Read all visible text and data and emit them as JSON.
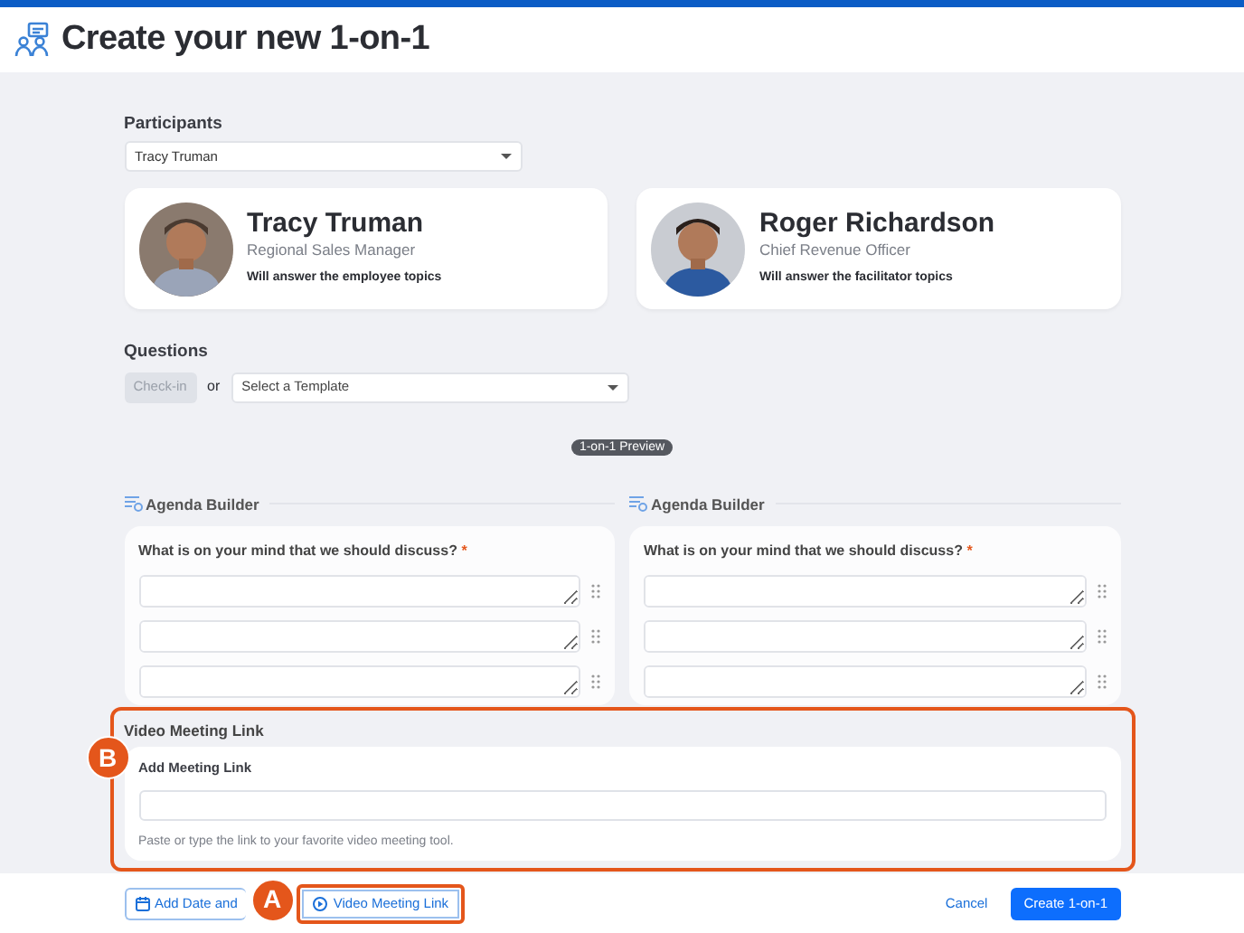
{
  "header": {
    "title": "Create your new 1-on-1"
  },
  "participants": {
    "label": "Participants",
    "value": "Tracy Truman"
  },
  "people": [
    {
      "name": "Tracy Truman",
      "role": "Regional Sales Manager",
      "note": "Will answer the employee topics"
    },
    {
      "name": "Roger Richardson",
      "role": "Chief Revenue Officer",
      "note": "Will answer the facilitator topics"
    }
  ],
  "questions": {
    "label": "Questions",
    "checkin": {
      "label": "Check-in",
      "disabled": true
    },
    "or_text": "or",
    "template": {
      "placeholder": "Select a Template"
    }
  },
  "preview_badge": "1-on-1 Preview",
  "agenda_columns": [
    {
      "heading": "Agenda Builder",
      "question": "What is on your mind that we should discuss?",
      "required": true,
      "required_mark": "*",
      "answers": [
        {
          "kind": "textarea"
        },
        {
          "kind": "textarea"
        },
        {
          "kind": "textarea"
        }
      ]
    },
    {
      "heading": "Agenda Builder",
      "question": "What is on your mind that we should discuss?",
      "required": true,
      "required_mark": "*",
      "answers": [
        {
          "kind": "textarea"
        },
        {
          "kind": "textarea"
        },
        {
          "kind": "textarea"
        }
      ]
    }
  ],
  "video_section": {
    "title": "Video Meeting Link",
    "highlighted": true,
    "callout": "B",
    "field_label": "Add Meeting Link",
    "help": "Paste or type the link to your favorite video meeting tool."
  },
  "footer": {
    "buttons": [
      {
        "label": "Add Date and",
        "kind": "date",
        "highlighted": false
      },
      {
        "label": "Video Meeting Link",
        "kind": "video",
        "highlighted": true,
        "callout": "A"
      },
      {
        "label": "Cancel",
        "kind": "link"
      },
      {
        "label": "Create 1-on-1",
        "kind": "primary"
      }
    ]
  }
}
